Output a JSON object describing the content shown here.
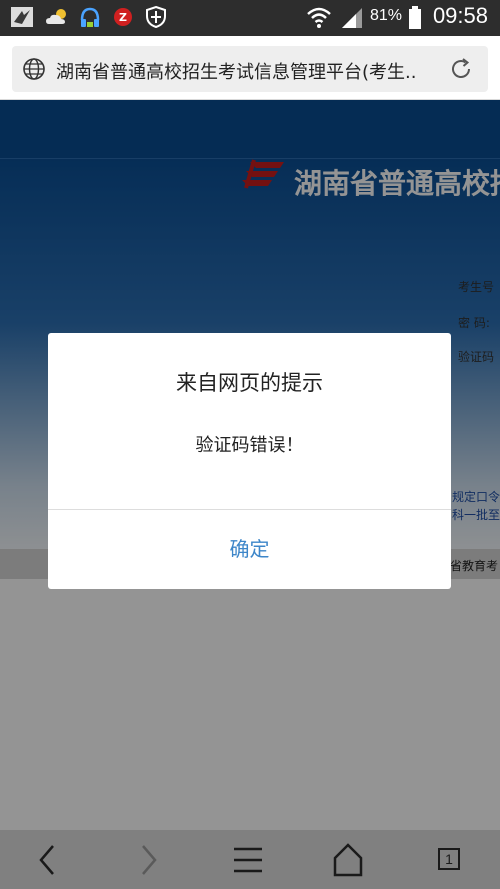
{
  "status_bar": {
    "battery_percent": "81%",
    "time": "09:58",
    "icons": [
      "app-notification-icon",
      "weather-icon",
      "headset-icon",
      "shield-z-icon",
      "security-icon",
      "wifi-icon",
      "signal-icon",
      "battery-icon"
    ]
  },
  "browser": {
    "url_text": "湖南省普通高校招生考试信息管理平台(考生..."
  },
  "page": {
    "site_title": "湖南省普通高校招",
    "labels": {
      "exam_no": "考生号",
      "password": "密  码:",
      "captcha": "验证码"
    },
    "links": {
      "line1": "规定口令一",
      "line2": "科一批至"
    },
    "footer": "省教育考"
  },
  "dialog": {
    "title": "来自网页的提示",
    "message": "验证码错误！",
    "ok_label": "确定"
  },
  "nav": {
    "tab_count": "1",
    "icons": [
      "back-icon",
      "forward-icon",
      "menu-icon",
      "home-icon",
      "tabs-icon"
    ]
  },
  "colors": {
    "header_blue": "#0a4d92",
    "dialog_button": "#3d86c9",
    "logo_red": "#c81e1e"
  }
}
